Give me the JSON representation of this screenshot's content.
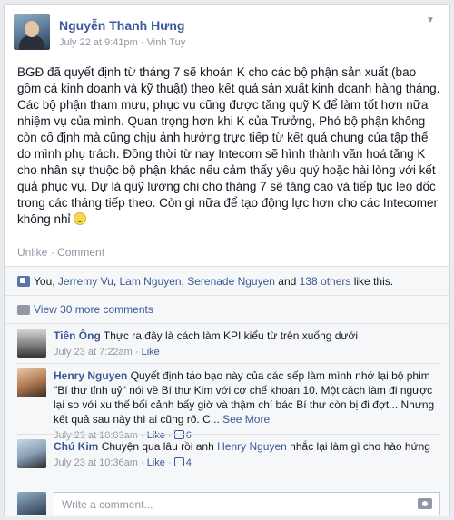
{
  "post": {
    "author": "Nguyễn Thanh Hưng",
    "date": "July 22 at 9:41pm",
    "location": "Vinh Tuy",
    "separator": " · ",
    "text": "BGĐ đã quyết định từ tháng 7 sẽ khoán K cho các bộ phận sản xuất (bao gồm cả kinh doanh và kỹ thuật) theo kết quả sản xuất kinh doanh hàng tháng. Các bộ phận tham mưu, phục vụ cũng được tăng quỹ K để làm tốt hơn nữa nhiệm vụ của mình. Quan trọng hơn khi K của Trưởng, Phó bộ phận không còn cố định mà cũng chịu ảnh hưởng trực tiếp từ kết quả chung của tập thể do mình phụ trách. Đồng thời từ nay Intecom sẽ hình thành văn hoá tăng K cho nhân sự thuộc bộ phận khác nếu cảm thấy yêu quý hoặc hài lòng với kết quả phục vụ. Dự là quỹ lương chi cho tháng 7 sẽ tăng cao và tiếp tục leo dốc trong các tháng tiếp theo. Còn gì nữa để tạo động lực hơn cho các Intecomer không nhỉ",
    "unlike": "Unlike",
    "comment": "Comment",
    "action_sep": " · "
  },
  "likes": {
    "you": "You",
    "names": [
      "Jerremy Vu",
      "Lam Nguyen",
      "Serenade Nguyen"
    ],
    "and": " and ",
    "others": "138 others",
    "suffix": " like this.",
    "comma": ", "
  },
  "view_more": "View 30 more comments",
  "comments": [
    {
      "name": "Tiên Ông",
      "text": "Thực ra đây là cách làm KPI kiểu từ trên xuống dưới",
      "date": "July 23 at 7:22am",
      "like": "Like"
    },
    {
      "name": "Henry Nguyen",
      "text": "Quyết định táo bạo này của các sếp làm mình nhớ lại bộ phim \"Bí thư tỉnh uỷ\" nói về Bí thư Kim với cơ chế khoán 10. Một cách làm đi ngược lại so với xu thế bối cảnh bấy giờ và thậm chí bác Bí thư còn bị đi đợt... Nhưng kết quả sau này thì ai cũng rõ. C...",
      "see_more": "See More",
      "date": "July 23 at 10:03am",
      "like": "Like",
      "like_count": "6"
    },
    {
      "name": "Chú Kim",
      "tag": "Henry Nguyen",
      "text_before": "Chuyện qua lâu rồi anh ",
      "text_after": " nhắc lại làm gì cho hào hứng",
      "date": "July 23 at 10:36am",
      "like": "Like",
      "like_count": "4"
    }
  ],
  "write_placeholder": "Write a comment...",
  "colors": {
    "link": "#3b5998",
    "meta": "#9197a3",
    "bg": "#f6f7f8"
  }
}
